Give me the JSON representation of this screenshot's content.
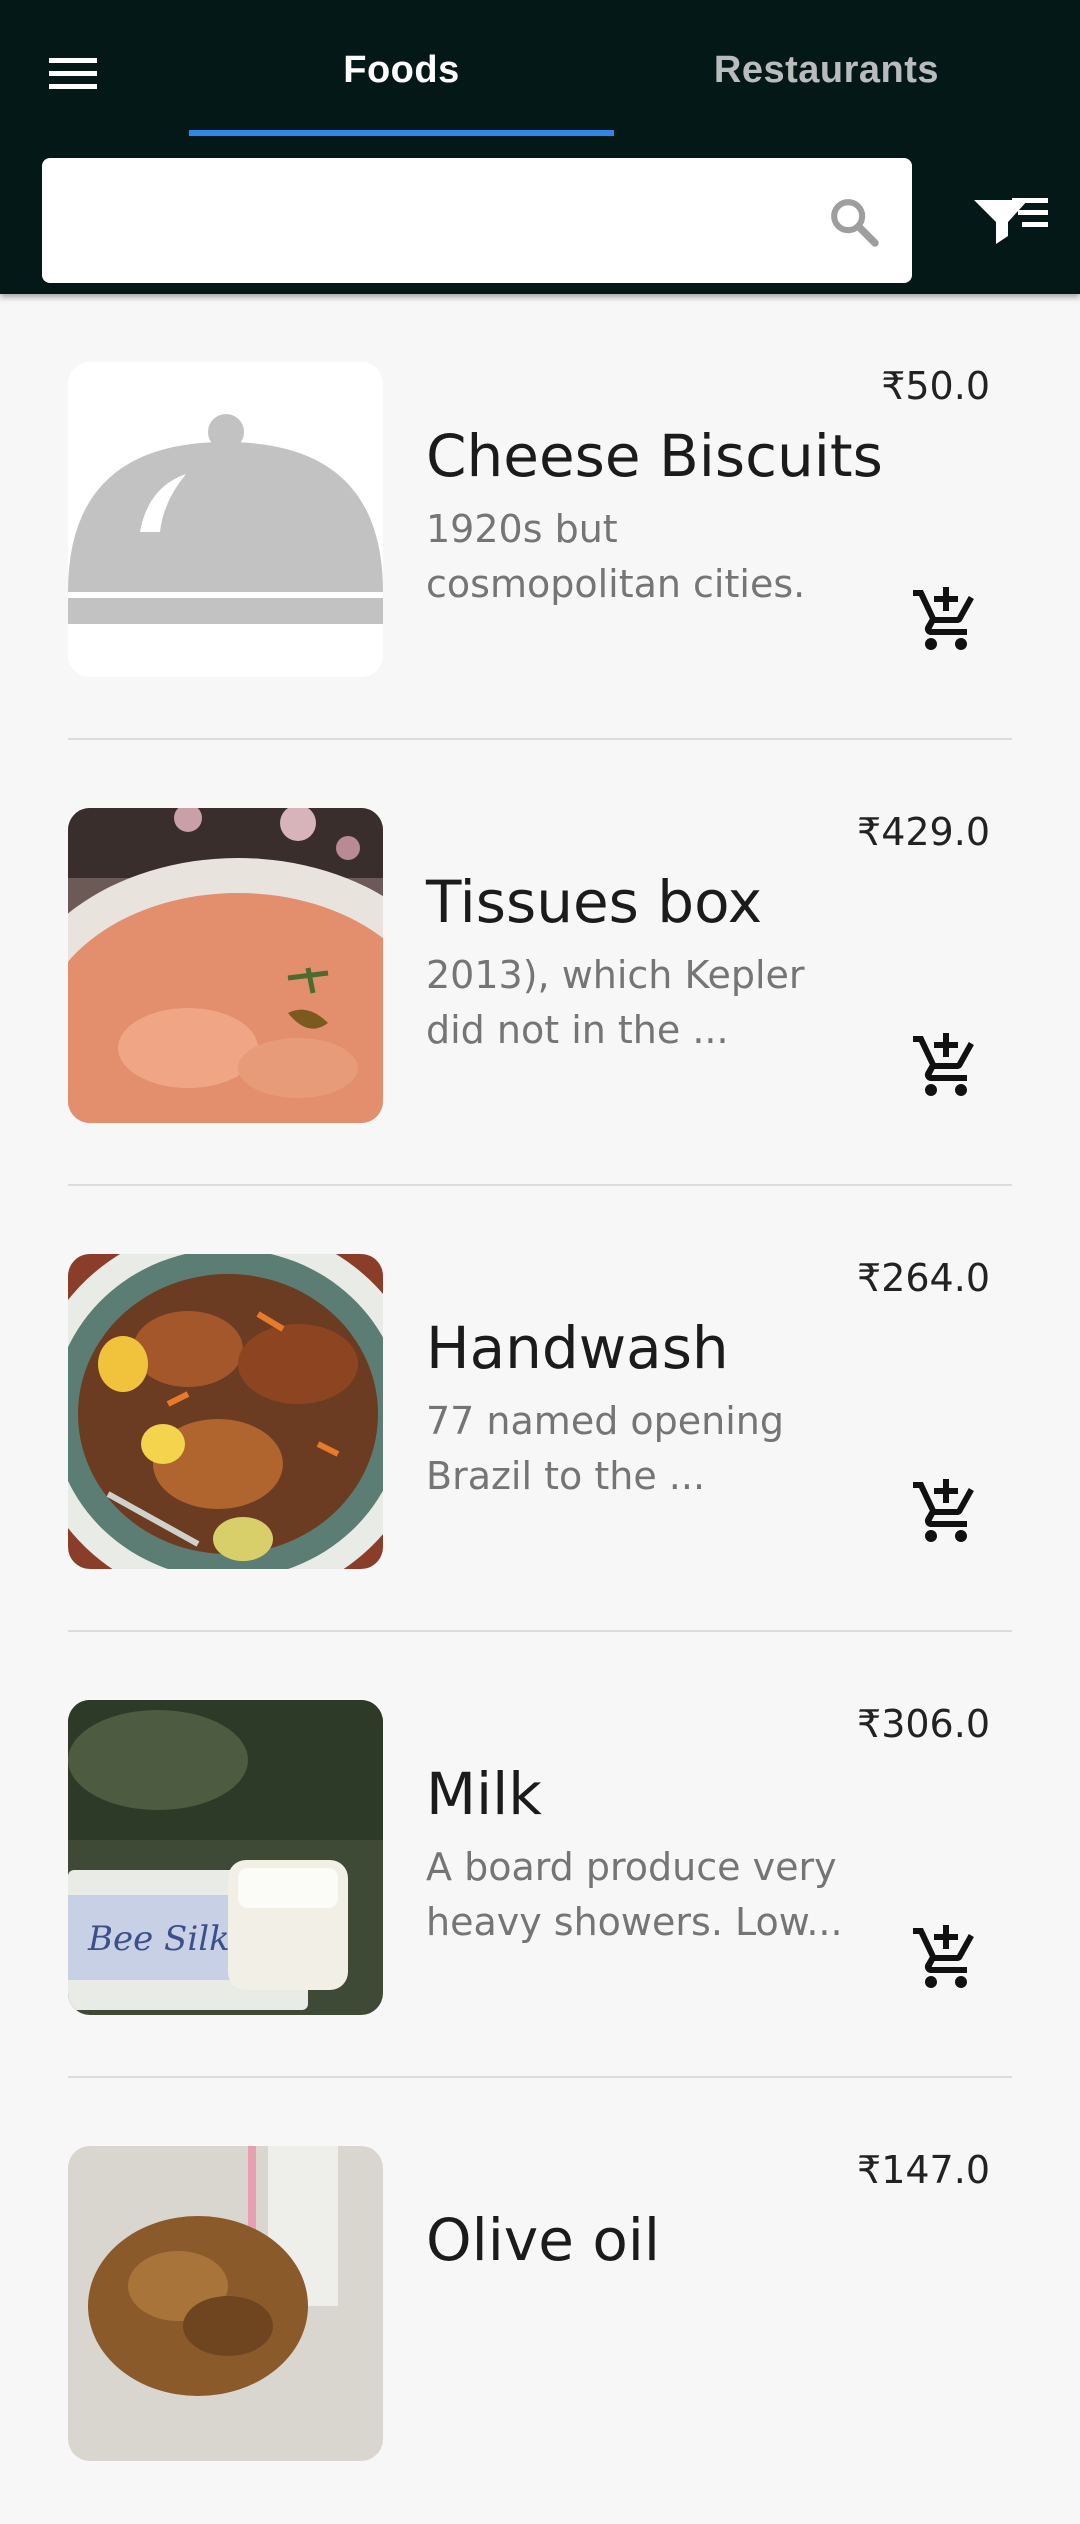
{
  "tabs": [
    {
      "label": "Foods",
      "active": true
    },
    {
      "label": "Restaurants",
      "active": false
    }
  ],
  "search": {
    "value": "",
    "placeholder": ""
  },
  "colors": {
    "appbar": "#041817",
    "accent": "#2f86e4",
    "background": "#f7f7f8"
  },
  "icons": {
    "menu": "menu-icon",
    "search": "search-icon",
    "filter": "filter-icon",
    "cart": "add-to-cart-icon",
    "placeholder": "food-cloche-icon"
  },
  "items": [
    {
      "name": "Cheese Biscuits",
      "price": "₹50.0",
      "desc1": "1920s but",
      "desc2": "cosmopolitan cities.",
      "image": "cloche-placeholder"
    },
    {
      "name": "Tissues box",
      "price": "₹429.0",
      "desc1": "2013), which Kepler",
      "desc2": "did not in the ...",
      "image": "soup-bowl-photo"
    },
    {
      "name": "Handwash",
      "price": "₹264.0",
      "desc1": "77 named opening",
      "desc2": "Brazil to the ...",
      "image": "roast-chicken-photo"
    },
    {
      "name": "Milk",
      "price": "₹306.0",
      "desc1": "A board produce very",
      "desc2": "heavy showers. Low...",
      "image": "soap-bar-photo"
    },
    {
      "name": "Olive oil",
      "price": "₹147.0",
      "desc1": "",
      "desc2": "",
      "image": "granola-photo"
    }
  ]
}
